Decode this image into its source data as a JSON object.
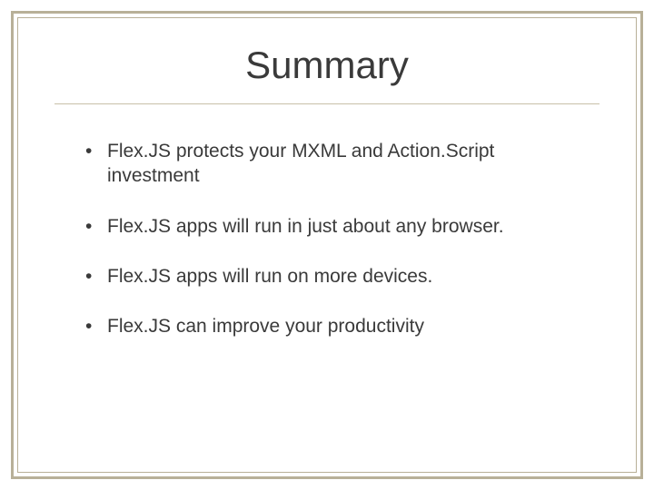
{
  "title": "Summary",
  "bullets": [
    "Flex.JS protects your MXML and Action.Script investment",
    "Flex.JS apps will run in just about any browser.",
    "Flex.JS apps will run on more devices.",
    "Flex.JS can improve your productivity"
  ]
}
